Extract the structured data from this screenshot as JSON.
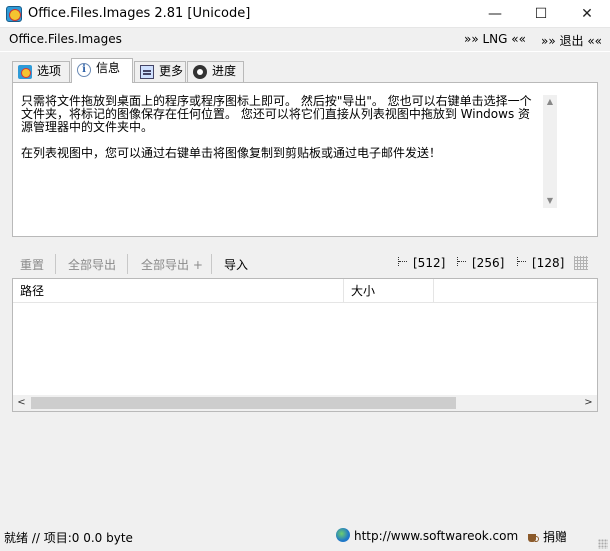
{
  "window": {
    "title": "Office.Files.Images 2.81 [Unicode]",
    "minimize_glyph": "—",
    "maximize_glyph": "☐",
    "close_glyph": "✕"
  },
  "menubar": {
    "app_label": "Office.Files.Images",
    "lng_label": "»» LNG ««",
    "exit_label": "»» 退出 ««"
  },
  "tabs": [
    {
      "label": "选项",
      "icon": "options-icon",
      "active": false
    },
    {
      "label": "信息",
      "icon": "info-icon",
      "active": true
    },
    {
      "label": "更多",
      "icon": "more-icon",
      "active": false
    },
    {
      "label": "进度",
      "icon": "progress-icon",
      "active": false
    }
  ],
  "info": {
    "paragraph1": "只需将文件拖放到桌面上的程序或程序图标上即可。 然后按\"导出\"。 您也可以右键单击选择一个文件夹，将标记的图像保存在任何位置。 您还可以将它们直接从列表视图中拖放到 Windows 资源管理器中的文件夹中。",
    "paragraph2": "在列表视图中，您可以通过右键单击将图像复制到剪贴板或通过电子邮件发送！"
  },
  "toolbar": {
    "reset": "重置",
    "export_all": "全部导出",
    "export_all_plus": "全部导出 +",
    "import": "导入",
    "size_512": "[512]",
    "size_256": "[256]",
    "size_128": "[128]"
  },
  "list": {
    "columns": [
      "路径",
      "大小"
    ],
    "rows": []
  },
  "status": {
    "text": "就绪 // 项目:0 0.0 byte",
    "url": "http://www.softwareok.com",
    "donate": "捐赠"
  },
  "colors": {
    "window_bg": "#f0f0f0",
    "panel_bg": "#ffffff",
    "disabled_text": "#8a8a8a"
  }
}
